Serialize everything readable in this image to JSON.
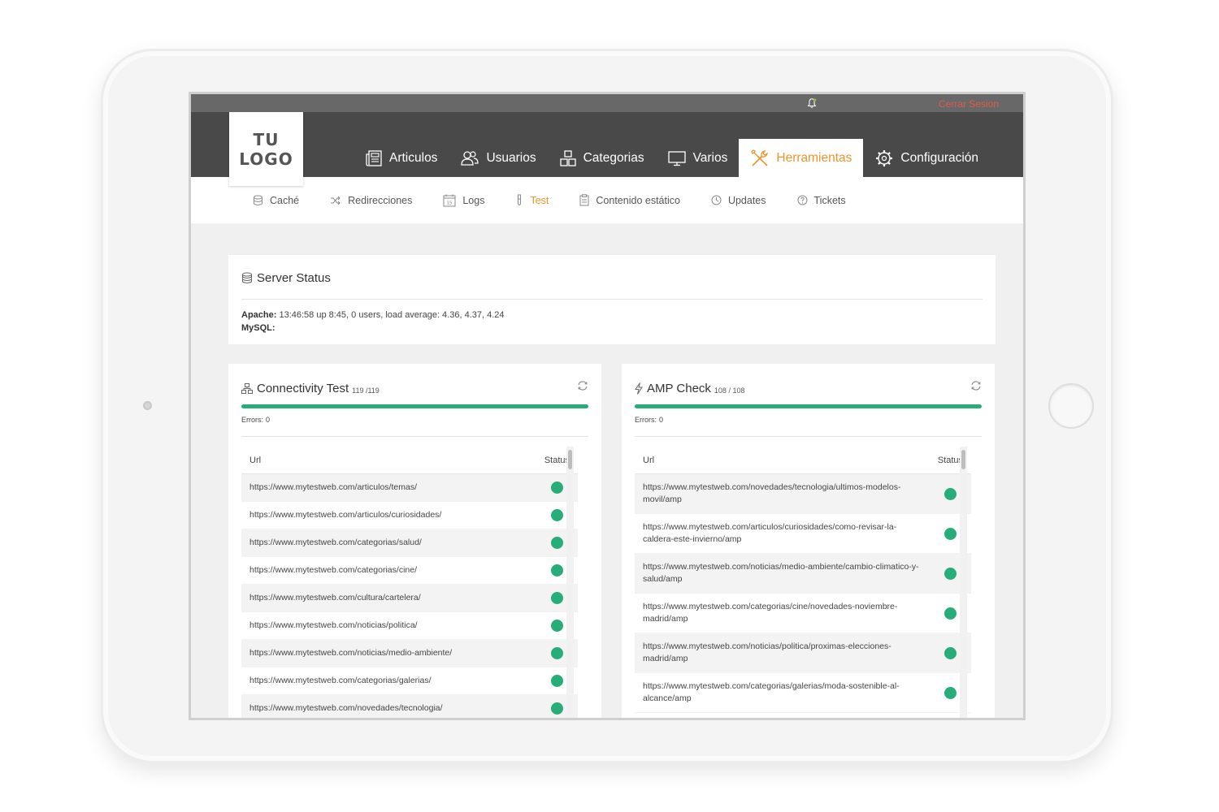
{
  "header": {
    "logo_line1": "TU",
    "logo_line2": "LOGO",
    "logout": "Cerrar Sesion",
    "icons": {
      "bell": "bell-icon"
    }
  },
  "nav": {
    "items": [
      {
        "label": "Articulos",
        "icon": "newspaper-icon",
        "active": false
      },
      {
        "label": "Usuarios",
        "icon": "users-icon",
        "active": false
      },
      {
        "label": "Categorias",
        "icon": "boxes-icon",
        "active": false
      },
      {
        "label": "Varios",
        "icon": "monitor-icon",
        "active": false
      },
      {
        "label": "Herramientas",
        "icon": "tools-icon",
        "active": true
      },
      {
        "label": "Configuración",
        "icon": "gear-icon",
        "active": false
      }
    ]
  },
  "subnav": {
    "items": [
      {
        "label": "Caché",
        "icon": "database-icon",
        "active": false
      },
      {
        "label": "Redirecciones",
        "icon": "shuffle-icon",
        "active": false
      },
      {
        "label": "Logs",
        "icon": "calendar-icon",
        "active": false
      },
      {
        "label": "Test",
        "icon": "test-tube-icon",
        "active": true
      },
      {
        "label": "Contenido estático",
        "icon": "clipboard-icon",
        "active": false
      },
      {
        "label": "Updates",
        "icon": "clock-icon",
        "active": false
      },
      {
        "label": "Tickets",
        "icon": "help-circle-icon",
        "active": false
      }
    ]
  },
  "server": {
    "title": "Server Status",
    "apache_label": "Apache:",
    "apache_value": "13:46:58 up 8:45, 0 users, load average: 4.36, 4.37, 4.24",
    "mysql_label": "MySQL:",
    "mysql_value": ""
  },
  "connectivity": {
    "title": "Connectivity Test",
    "count": "119 /119",
    "progress": 1.0,
    "errors_label": "Errors:",
    "errors_value": "0",
    "col_url": "Url",
    "col_status": "Status",
    "rows": [
      {
        "url": "https://www.mytestweb.com/articulos/temas/",
        "status": "ok"
      },
      {
        "url": "https://www.mytestweb.com/articulos/curiosidades/",
        "status": "ok"
      },
      {
        "url": "https://www.mytestweb.com/categorias/salud/",
        "status": "ok"
      },
      {
        "url": "https://www.mytestweb.com/categorias/cine/",
        "status": "ok"
      },
      {
        "url": "https://www.mytestweb.com/cultura/cartelera/",
        "status": "ok"
      },
      {
        "url": "https://www.mytestweb.com/noticias/politica/",
        "status": "ok"
      },
      {
        "url": "https://www.mytestweb.com/noticias/medio-ambiente/",
        "status": "ok"
      },
      {
        "url": "https://www.mytestweb.com/categorias/galerias/",
        "status": "ok"
      },
      {
        "url": "https://www.mytestweb.com/novedades/tecnologia/",
        "status": "ok"
      }
    ]
  },
  "amp": {
    "title": "AMP Check",
    "count": "108 / 108",
    "progress": 1.0,
    "errors_label": "Errors:",
    "errors_value": "0",
    "col_url": "Url",
    "col_status": "Status",
    "rows": [
      {
        "url": "https://www.mytestweb.com/novedades/tecnologia/ultimos-modelos-movil/amp",
        "status": "ok"
      },
      {
        "url": "https://www.mytestweb.com/articulos/curiosidades/como-revisar-la-caldera-este-invierno/amp",
        "status": "ok"
      },
      {
        "url": "https://www.mytestweb.com/noticias/medio-ambiente/cambio-climatico-y-salud/amp",
        "status": "ok"
      },
      {
        "url": "https://www.mytestweb.com/categorias/cine/novedades-noviembre-madrid/amp",
        "status": "ok"
      },
      {
        "url": "https://www.mytestweb.com/noticias/politica/proximas-elecciones-madrid/amp",
        "status": "ok"
      },
      {
        "url": "https://www.mytestweb.com/categorias/galerias/moda-sostenible-al-alcance/amp",
        "status": "ok"
      }
    ]
  },
  "colors": {
    "accent": "#e8962a",
    "ok": "#27ae78",
    "navbar": "#494949",
    "logout": "#e05b46"
  }
}
